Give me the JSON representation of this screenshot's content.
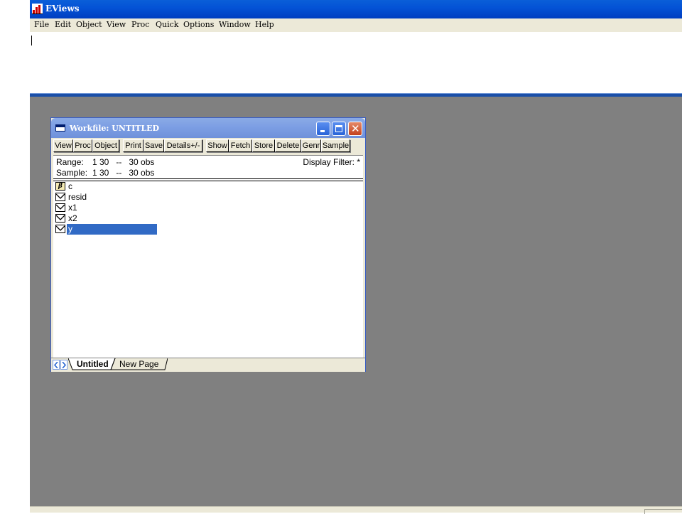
{
  "app": {
    "title": "EViews"
  },
  "menu": [
    "File",
    "Edit",
    "Object",
    "View",
    "Proc",
    "Quick",
    "Options",
    "Window",
    "Help"
  ],
  "workfile": {
    "title": "Workfile: UNTITLED",
    "toolbar": [
      "View",
      "Proc",
      "Object",
      "Print",
      "Save",
      "Details+/-",
      "Show",
      "Fetch",
      "Store",
      "Delete",
      "Genr",
      "Sample"
    ],
    "range_label": "Range:",
    "range_value": "1 30   --   30 obs",
    "sample_label": "Sample:",
    "sample_value": "1 30   --   30 obs",
    "display_filter": "Display Filter: *",
    "objects": [
      {
        "name": "c",
        "icon": "coefficient-icon",
        "selected": false
      },
      {
        "name": "resid",
        "icon": "series-icon",
        "selected": false
      },
      {
        "name": "x1",
        "icon": "series-icon",
        "selected": false
      },
      {
        "name": "x2",
        "icon": "series-icon",
        "selected": false
      },
      {
        "name": "y",
        "icon": "series-icon",
        "selected": true
      }
    ],
    "tabs": [
      "Untitled",
      "New Page"
    ]
  },
  "colors": {
    "titlebar": "#0453d6",
    "selection": "#316ac5",
    "workarea": "#808080"
  }
}
